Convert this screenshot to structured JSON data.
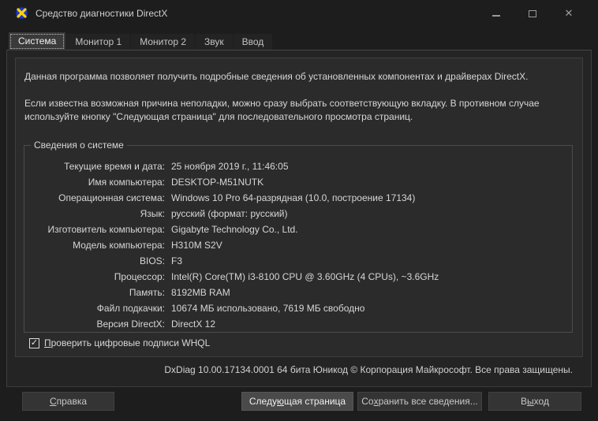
{
  "window": {
    "title": "Средство диагностики DirectX",
    "icons": {
      "close_glyph": "✕"
    }
  },
  "tabs": [
    {
      "label": "Система",
      "active": true
    },
    {
      "label": "Монитор 1",
      "active": false
    },
    {
      "label": "Монитор 2",
      "active": false
    },
    {
      "label": "Звук",
      "active": false
    },
    {
      "label": "Ввод",
      "active": false
    }
  ],
  "intro": {
    "p1": "Данная программа позволяет получить подробные сведения об установленных компонентах и драйверах DirectX.",
    "p2": "Если известна возможная причина неполадки, можно сразу выбрать соответствующую вкладку. В противном случае используйте кнопку \"Следующая страница\" для последовательного просмотра страниц."
  },
  "system_info": {
    "legend": "Сведения о системе",
    "rows": [
      {
        "label": "Текущие время и дата:",
        "value": "25 ноября 2019 г., 11:46:05"
      },
      {
        "label": "Имя компьютера:",
        "value": "DESKTOP-M51NUTK"
      },
      {
        "label": "Операционная система:",
        "value": "Windows 10 Pro 64-разрядная (10.0, построение 17134)"
      },
      {
        "label": "Язык:",
        "value": "русский (формат: русский)"
      },
      {
        "label": "Изготовитель компьютера:",
        "value": "Gigabyte Technology Co., Ltd."
      },
      {
        "label": "Модель компьютера:",
        "value": "H310M S2V"
      },
      {
        "label": "BIOS:",
        "value": "F3"
      },
      {
        "label": "Процессор:",
        "value": "Intel(R) Core(TM) i3-8100 CPU @ 3.60GHz (4 CPUs), ~3.6GHz"
      },
      {
        "label": "Память:",
        "value": "8192MB RAM"
      },
      {
        "label": "Файл подкачки:",
        "value": "10674 МБ использовано, 7619 МБ свободно"
      },
      {
        "label": "Версия DirectX:",
        "value": "DirectX 12"
      }
    ]
  },
  "whql": {
    "label": "Проверить цифровые подписи WHQL",
    "accel": 0,
    "checked": true,
    "check_glyph": "✓"
  },
  "status_line": "DxDiag 10.00.17134.0001 64 бита Юникод © Корпорация Майкрософт. Все права защищены.",
  "buttons": {
    "help": {
      "label": "Справка",
      "accel": 0
    },
    "next": {
      "label": "Следующая страница",
      "accel": 5
    },
    "save": {
      "label": "Сохранить все сведения...",
      "accel": 2
    },
    "exit": {
      "label": "Выход",
      "accel": 1
    }
  },
  "colors": {
    "window_bg": "#1d1d1d",
    "panel_bg": "#2b2b2b",
    "text": "#d6d6d6",
    "default_button_bg": "#4a4a4a",
    "icon_blue": "#2138c6",
    "icon_yellow": "#ffd400"
  }
}
